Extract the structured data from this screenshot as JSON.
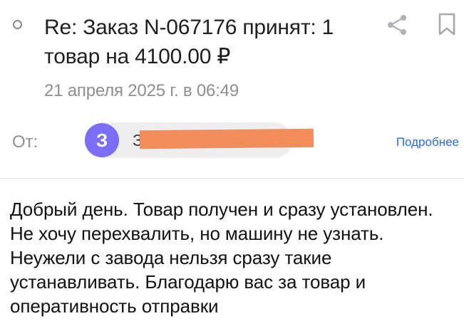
{
  "header": {
    "subject": "Re: Заказ N-067176 принят: 1 товар на 4100.00 ₽",
    "date": "21 апреля 2025 г. в 06:49"
  },
  "sender": {
    "from_label": "От:",
    "avatar_letter": "З",
    "name": "З",
    "details_label": "Подробнее"
  },
  "icons": {
    "unread": "unread-dot-icon",
    "share": "share-icon",
    "bookmark": "bookmark-icon"
  },
  "colors": {
    "avatar": "#7b6ef6",
    "link": "#2b6cd8",
    "muted_text": "#8e8e93",
    "redaction": "#f28c58"
  },
  "message": {
    "body": "Добрый день. Товар получен и сразу установлен. Не хочу перехвалить, но машину не узнать. Неужели с завода нельзя сразу такие устанавливать. Благодарю вас за товар и оперативность отправки"
  }
}
